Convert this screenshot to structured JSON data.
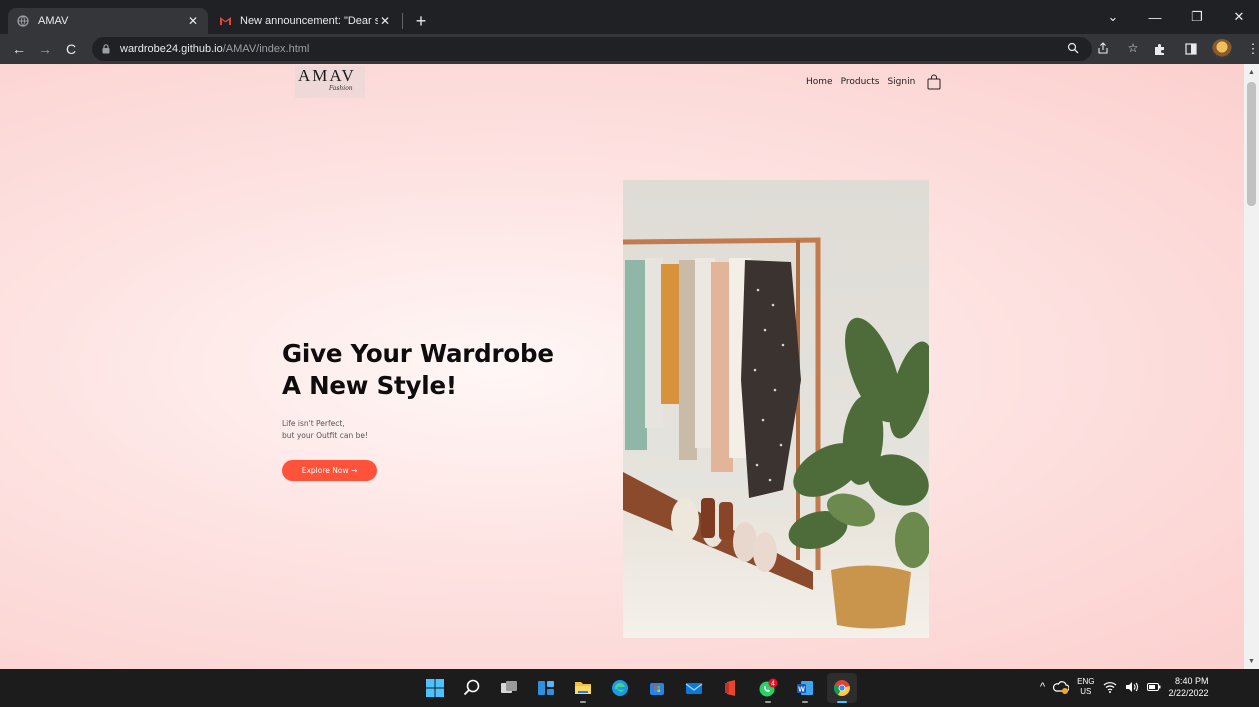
{
  "browser": {
    "tabs": [
      {
        "title": "AMAV",
        "active": true
      },
      {
        "title": "New announcement: \"Dear stude",
        "active": false
      }
    ],
    "url_host": "wardrobe24.github.io",
    "url_path": "/AMAV/index.html"
  },
  "site": {
    "logo_main": "AMAV",
    "logo_sub": "Fashion",
    "nav": [
      "Home",
      "Products",
      "Signin"
    ],
    "hero": {
      "title_line1": "Give Your Wardrobe",
      "title_line2": "A New Style!",
      "subtitle_line1": "Life isn't Perfect,",
      "subtitle_line2": "but your Outfit can be!",
      "cta": "Explore Now →"
    },
    "accent_color": "#ff523b"
  },
  "taskbar": {
    "lang_top": "ENG",
    "lang_bottom": "US",
    "time": "8:40 PM",
    "date": "2/22/2022",
    "whatsapp_badge": "4"
  }
}
